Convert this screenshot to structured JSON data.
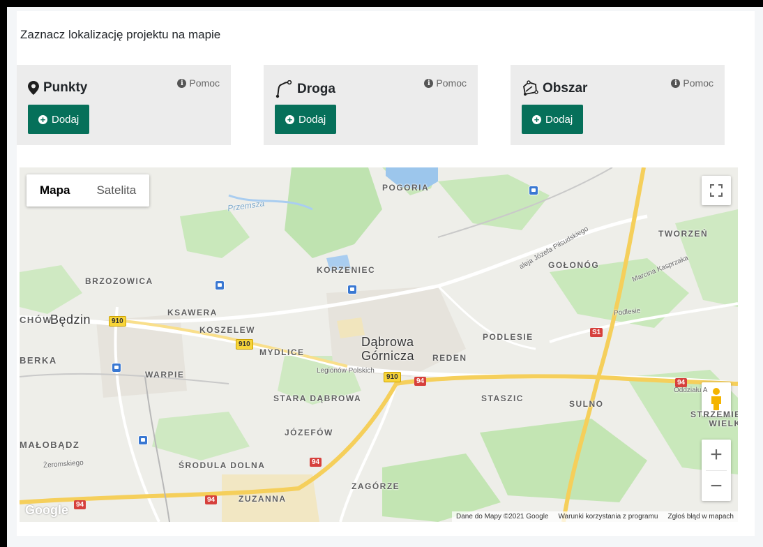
{
  "title": "Zaznacz lokalizację projektu na mapie",
  "tools": [
    {
      "name": "Punkty",
      "icon": "map-marker-icon",
      "help": "Pomoc",
      "add": "Dodaj"
    },
    {
      "name": "Droga",
      "icon": "route-icon",
      "help": "Pomoc",
      "add": "Dodaj"
    },
    {
      "name": "Obszar",
      "icon": "polygon-icon",
      "help": "Pomoc",
      "add": "Dodaj"
    }
  ],
  "map": {
    "types": [
      "Mapa",
      "Satelita"
    ],
    "active_type": "Mapa",
    "labels": {
      "bedzin": "Będzin",
      "chow": "CHÓW",
      "dabrowa": "Dąbrowa\nGórnicza",
      "brzozowica": "BRZOZOWICA",
      "ksawera": "KSAWERA",
      "koszelew": "KOSZELEW",
      "mydlice": "MYDLICE",
      "korzeniec": "KORZENIEC",
      "pogoria": "POGORIA",
      "tworzen": "TWORZEŃ",
      "golonog": "GOŁONÓG",
      "podlesie": "PODLESIE",
      "reden": "REDEN",
      "berka": "BERKA",
      "warpie": "WARPIE",
      "stara_dabrowa": "STARA DĄBROWA",
      "staszic": "STASZIC",
      "sulno": "SULNO",
      "strzemieszyce": "STRZEMIE\nWIELK",
      "jozefow": "JÓZEFÓW",
      "malobadz": "MAŁOBĄDZ",
      "srodula": "ŚRODULA DOLNA",
      "zagorze": "ZAGÓRZE",
      "zuzanna": "ZUZANNA",
      "przemsza": "Przemsza",
      "legionow": "Legionów Polskich",
      "aleja": "aleja Józefa Piłsudskiego",
      "zeromskiego": "Żeromskiego",
      "oddzialu": "Oddziału A",
      "podlesie_st": "Podlesie",
      "marcina": "Marcina Kasprzaka"
    },
    "shields": {
      "r910a": "910",
      "r910b": "910",
      "r910c": "910",
      "r94a": "94",
      "r94b": "94",
      "r94c": "94",
      "r94d": "94",
      "r94e": "94",
      "s1": "S1"
    },
    "attribution": {
      "data": "Dane do Mapy ©2021 Google",
      "terms": "Warunki korzystania z programu",
      "report": "Zgłoś błąd w mapach"
    },
    "logo": "Google",
    "zoom_in": "+",
    "zoom_out": "−"
  }
}
